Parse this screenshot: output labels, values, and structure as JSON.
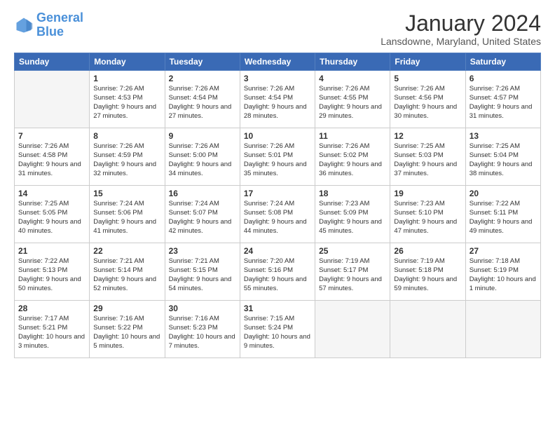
{
  "header": {
    "logo_line1": "General",
    "logo_line2": "Blue",
    "month_year": "January 2024",
    "location": "Lansdowne, Maryland, United States"
  },
  "weekdays": [
    "Sunday",
    "Monday",
    "Tuesday",
    "Wednesday",
    "Thursday",
    "Friday",
    "Saturday"
  ],
  "weeks": [
    [
      {
        "day": null,
        "sunrise": null,
        "sunset": null,
        "daylight": null
      },
      {
        "day": "1",
        "sunrise": "Sunrise: 7:26 AM",
        "sunset": "Sunset: 4:53 PM",
        "daylight": "Daylight: 9 hours and 27 minutes."
      },
      {
        "day": "2",
        "sunrise": "Sunrise: 7:26 AM",
        "sunset": "Sunset: 4:54 PM",
        "daylight": "Daylight: 9 hours and 27 minutes."
      },
      {
        "day": "3",
        "sunrise": "Sunrise: 7:26 AM",
        "sunset": "Sunset: 4:54 PM",
        "daylight": "Daylight: 9 hours and 28 minutes."
      },
      {
        "day": "4",
        "sunrise": "Sunrise: 7:26 AM",
        "sunset": "Sunset: 4:55 PM",
        "daylight": "Daylight: 9 hours and 29 minutes."
      },
      {
        "day": "5",
        "sunrise": "Sunrise: 7:26 AM",
        "sunset": "Sunset: 4:56 PM",
        "daylight": "Daylight: 9 hours and 30 minutes."
      },
      {
        "day": "6",
        "sunrise": "Sunrise: 7:26 AM",
        "sunset": "Sunset: 4:57 PM",
        "daylight": "Daylight: 9 hours and 31 minutes."
      }
    ],
    [
      {
        "day": "7",
        "sunrise": "Sunrise: 7:26 AM",
        "sunset": "Sunset: 4:58 PM",
        "daylight": "Daylight: 9 hours and 31 minutes."
      },
      {
        "day": "8",
        "sunrise": "Sunrise: 7:26 AM",
        "sunset": "Sunset: 4:59 PM",
        "daylight": "Daylight: 9 hours and 32 minutes."
      },
      {
        "day": "9",
        "sunrise": "Sunrise: 7:26 AM",
        "sunset": "Sunset: 5:00 PM",
        "daylight": "Daylight: 9 hours and 34 minutes."
      },
      {
        "day": "10",
        "sunrise": "Sunrise: 7:26 AM",
        "sunset": "Sunset: 5:01 PM",
        "daylight": "Daylight: 9 hours and 35 minutes."
      },
      {
        "day": "11",
        "sunrise": "Sunrise: 7:26 AM",
        "sunset": "Sunset: 5:02 PM",
        "daylight": "Daylight: 9 hours and 36 minutes."
      },
      {
        "day": "12",
        "sunrise": "Sunrise: 7:25 AM",
        "sunset": "Sunset: 5:03 PM",
        "daylight": "Daylight: 9 hours and 37 minutes."
      },
      {
        "day": "13",
        "sunrise": "Sunrise: 7:25 AM",
        "sunset": "Sunset: 5:04 PM",
        "daylight": "Daylight: 9 hours and 38 minutes."
      }
    ],
    [
      {
        "day": "14",
        "sunrise": "Sunrise: 7:25 AM",
        "sunset": "Sunset: 5:05 PM",
        "daylight": "Daylight: 9 hours and 40 minutes."
      },
      {
        "day": "15",
        "sunrise": "Sunrise: 7:24 AM",
        "sunset": "Sunset: 5:06 PM",
        "daylight": "Daylight: 9 hours and 41 minutes."
      },
      {
        "day": "16",
        "sunrise": "Sunrise: 7:24 AM",
        "sunset": "Sunset: 5:07 PM",
        "daylight": "Daylight: 9 hours and 42 minutes."
      },
      {
        "day": "17",
        "sunrise": "Sunrise: 7:24 AM",
        "sunset": "Sunset: 5:08 PM",
        "daylight": "Daylight: 9 hours and 44 minutes."
      },
      {
        "day": "18",
        "sunrise": "Sunrise: 7:23 AM",
        "sunset": "Sunset: 5:09 PM",
        "daylight": "Daylight: 9 hours and 45 minutes."
      },
      {
        "day": "19",
        "sunrise": "Sunrise: 7:23 AM",
        "sunset": "Sunset: 5:10 PM",
        "daylight": "Daylight: 9 hours and 47 minutes."
      },
      {
        "day": "20",
        "sunrise": "Sunrise: 7:22 AM",
        "sunset": "Sunset: 5:11 PM",
        "daylight": "Daylight: 9 hours and 49 minutes."
      }
    ],
    [
      {
        "day": "21",
        "sunrise": "Sunrise: 7:22 AM",
        "sunset": "Sunset: 5:13 PM",
        "daylight": "Daylight: 9 hours and 50 minutes."
      },
      {
        "day": "22",
        "sunrise": "Sunrise: 7:21 AM",
        "sunset": "Sunset: 5:14 PM",
        "daylight": "Daylight: 9 hours and 52 minutes."
      },
      {
        "day": "23",
        "sunrise": "Sunrise: 7:21 AM",
        "sunset": "Sunset: 5:15 PM",
        "daylight": "Daylight: 9 hours and 54 minutes."
      },
      {
        "day": "24",
        "sunrise": "Sunrise: 7:20 AM",
        "sunset": "Sunset: 5:16 PM",
        "daylight": "Daylight: 9 hours and 55 minutes."
      },
      {
        "day": "25",
        "sunrise": "Sunrise: 7:19 AM",
        "sunset": "Sunset: 5:17 PM",
        "daylight": "Daylight: 9 hours and 57 minutes."
      },
      {
        "day": "26",
        "sunrise": "Sunrise: 7:19 AM",
        "sunset": "Sunset: 5:18 PM",
        "daylight": "Daylight: 9 hours and 59 minutes."
      },
      {
        "day": "27",
        "sunrise": "Sunrise: 7:18 AM",
        "sunset": "Sunset: 5:19 PM",
        "daylight": "Daylight: 10 hours and 1 minute."
      }
    ],
    [
      {
        "day": "28",
        "sunrise": "Sunrise: 7:17 AM",
        "sunset": "Sunset: 5:21 PM",
        "daylight": "Daylight: 10 hours and 3 minutes."
      },
      {
        "day": "29",
        "sunrise": "Sunrise: 7:16 AM",
        "sunset": "Sunset: 5:22 PM",
        "daylight": "Daylight: 10 hours and 5 minutes."
      },
      {
        "day": "30",
        "sunrise": "Sunrise: 7:16 AM",
        "sunset": "Sunset: 5:23 PM",
        "daylight": "Daylight: 10 hours and 7 minutes."
      },
      {
        "day": "31",
        "sunrise": "Sunrise: 7:15 AM",
        "sunset": "Sunset: 5:24 PM",
        "daylight": "Daylight: 10 hours and 9 minutes."
      },
      {
        "day": null,
        "sunrise": null,
        "sunset": null,
        "daylight": null
      },
      {
        "day": null,
        "sunrise": null,
        "sunset": null,
        "daylight": null
      },
      {
        "day": null,
        "sunrise": null,
        "sunset": null,
        "daylight": null
      }
    ]
  ]
}
